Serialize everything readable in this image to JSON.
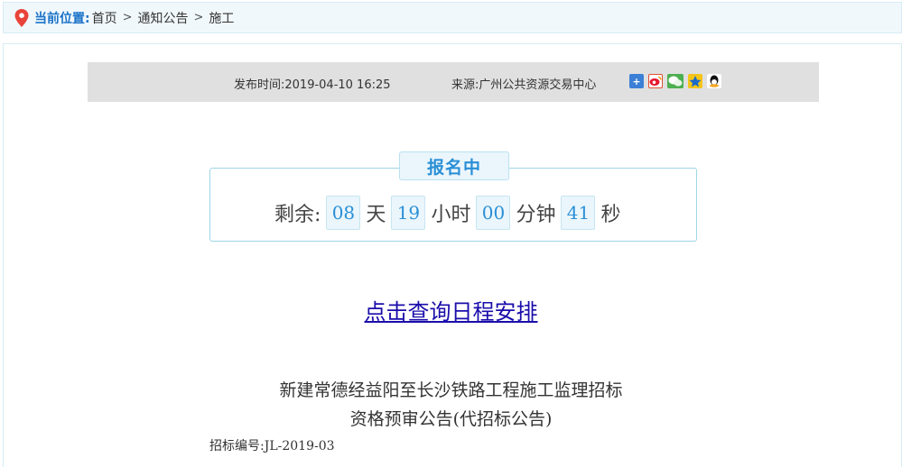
{
  "breadcrumb": {
    "label": "当前位置:",
    "items": [
      "首页",
      "通知公告",
      "施工"
    ],
    "separator": ">"
  },
  "meta": {
    "publish_time": "发布时间:2019-04-10 16:25",
    "source": "来源:广州公共资源交易中心",
    "share_icons": [
      "plus-share-icon",
      "weibo-icon",
      "wechat-icon",
      "qzone-icon",
      "qq-icon"
    ]
  },
  "countdown": {
    "status": "报名中",
    "prefix": "剩余:",
    "days": "08",
    "days_unit": "天",
    "hours": "19",
    "hours_unit": "小时",
    "minutes": "00",
    "minutes_unit": "分钟",
    "seconds": "41",
    "seconds_unit": "秒"
  },
  "schedule_link": "点击查询日程安排",
  "notice": {
    "title_line1": "新建常德经益阳至长沙铁路工程施工监理招标",
    "title_line2": "资格预审公告(代招标公告)",
    "tender_no": "招标编号:JL-2019-03"
  },
  "colors": {
    "accent": "#2a8fd6",
    "breadcrumb_bg": "#f1f8fc",
    "meta_bg": "#e0e0e0",
    "link": "#1a0dab",
    "pin": "#e8443a"
  }
}
